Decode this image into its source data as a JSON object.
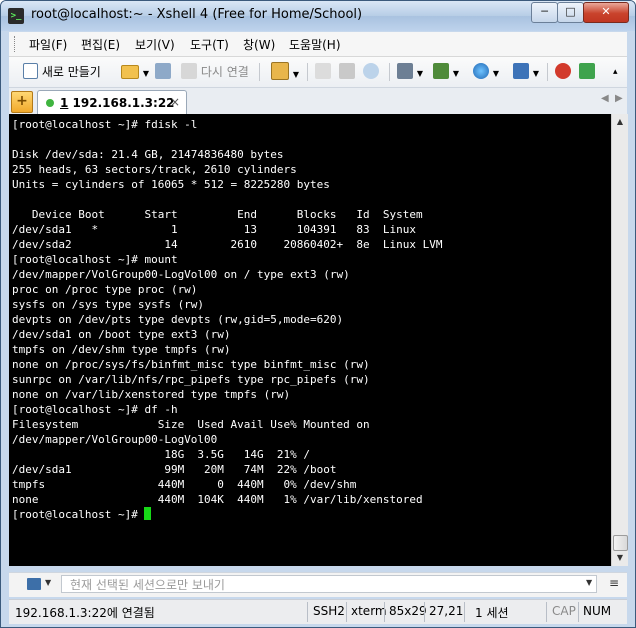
{
  "window": {
    "title": "root@localhost:~ - Xshell 4 (Free for Home/School)",
    "app_icon": "xshell-terminal-icon",
    "controls": {
      "minimize": "─",
      "maximize": "□",
      "close": "✕"
    }
  },
  "menu": [
    "파일(F)",
    "편집(E)",
    "보기(V)",
    "도구(T)",
    "창(W)",
    "도움말(H)"
  ],
  "toolbar": {
    "new_label": "새로 만들기",
    "reconnect_label": "다시 연결"
  },
  "tabs": [
    {
      "number": "1",
      "label": "192.168.1.3:22",
      "close": "×",
      "status_color": "#3fb43f"
    }
  ],
  "terminal": {
    "lines": [
      "[root@localhost ~]# fdisk -l",
      "",
      "Disk /dev/sda: 21.4 GB, 21474836480 bytes",
      "255 heads, 63 sectors/track, 2610 cylinders",
      "Units = cylinders of 16065 * 512 = 8225280 bytes",
      "",
      "   Device Boot      Start         End      Blocks   Id  System",
      "/dev/sda1   *           1          13      104391   83  Linux",
      "/dev/sda2              14        2610    20860402+  8e  Linux LVM",
      "[root@localhost ~]# mount",
      "/dev/mapper/VolGroup00-LogVol00 on / type ext3 (rw)",
      "proc on /proc type proc (rw)",
      "sysfs on /sys type sysfs (rw)",
      "devpts on /dev/pts type devpts (rw,gid=5,mode=620)",
      "/dev/sda1 on /boot type ext3 (rw)",
      "tmpfs on /dev/shm type tmpfs (rw)",
      "none on /proc/sys/fs/binfmt_misc type binfmt_misc (rw)",
      "sunrpc on /var/lib/nfs/rpc_pipefs type rpc_pipefs (rw)",
      "none on /var/lib/xenstored type tmpfs (rw)",
      "[root@localhost ~]# df -h",
      "Filesystem            Size  Used Avail Use% Mounted on",
      "/dev/mapper/VolGroup00-LogVol00",
      "                       18G  3.5G   14G  21% /",
      "/dev/sda1              99M   20M   74M  22% /boot",
      "tmpfs                 440M     0  440M   0% /dev/shm",
      "none                  440M  104K  440M   1% /var/lib/xenstored"
    ],
    "prompt": "[root@localhost ~]# ",
    "background": "#000000",
    "cursor_color": "#17d817"
  },
  "compose": {
    "placeholder": "현재 선택된 세션으로만 보내기"
  },
  "status": {
    "connection": "192.168.1.3:22에 연결됨",
    "protocol": "SSH2",
    "terminal_type": "xterm",
    "size": "85x29",
    "cursor_pos": "27,21",
    "sessions": "1 세션",
    "caps": "CAP",
    "num": "NUM"
  }
}
